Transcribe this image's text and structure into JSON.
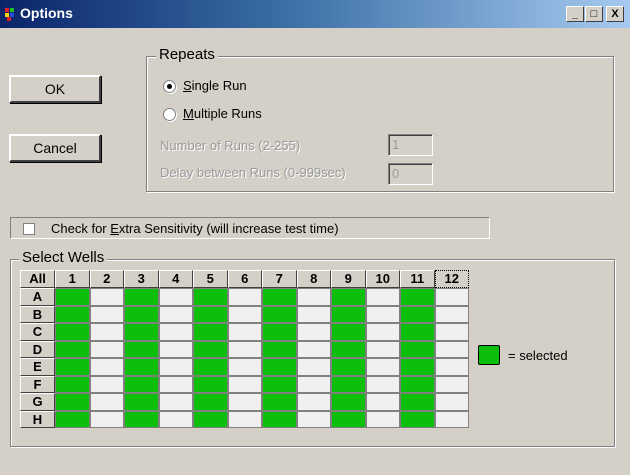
{
  "window": {
    "title": "Options",
    "minimize_label": "_",
    "maximize_label": "□",
    "close_label": "X"
  },
  "buttons": {
    "ok_label": "OK",
    "cancel_label": "Cancel"
  },
  "repeats": {
    "group_label": "Repeats",
    "single_run": {
      "accel": "S",
      "rest": "ingle Run",
      "checked": true
    },
    "multiple_runs": {
      "accel": "M",
      "rest": "ultiple Runs",
      "checked": false
    },
    "number_of_runs_label": "Number of Runs (2-255)",
    "number_of_runs_value": "1",
    "delay_label": "Delay between Runs (0-999sec)",
    "delay_value": "0"
  },
  "extra_sensitivity": {
    "prefix": "Check for ",
    "accel": "E",
    "rest": "xtra Sensitivity (will increase test time)",
    "checked": false
  },
  "select_wells": {
    "group_label": "Select Wells",
    "all_label": "All",
    "columns": [
      "1",
      "2",
      "3",
      "4",
      "5",
      "6",
      "7",
      "8",
      "9",
      "10",
      "11",
      "12"
    ],
    "rows": [
      "A",
      "B",
      "C",
      "D",
      "E",
      "F",
      "G",
      "H"
    ],
    "selected_columns": [
      "1",
      "3",
      "5",
      "7",
      "9",
      "11"
    ],
    "selected_color": "#0bbf0b",
    "legend_label": "= selected"
  }
}
